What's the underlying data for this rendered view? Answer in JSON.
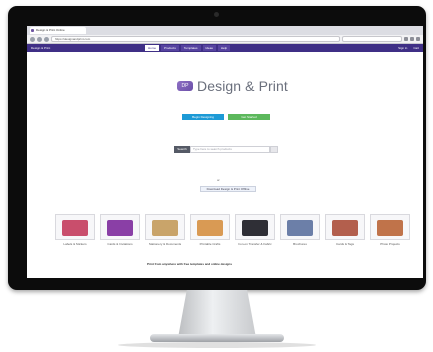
{
  "browser": {
    "tab_title": "Design & Print Online",
    "url": "https://designandprint.com"
  },
  "site_nav": {
    "brand": "Design & Print",
    "menu": [
      {
        "label": "Home",
        "active": true
      },
      {
        "label": "Products",
        "active": false
      },
      {
        "label": "Templates",
        "active": false
      },
      {
        "label": "Ideas",
        "active": false
      },
      {
        "label": "Help",
        "active": false
      }
    ],
    "right": [
      "Sign in",
      "Cart"
    ]
  },
  "hero": {
    "logo_mark": "DP",
    "logo_text": "Design & Print"
  },
  "cta": {
    "primary": "Begin Designing",
    "secondary": "Get Started"
  },
  "search": {
    "label": "Search",
    "placeholder": "Type here to search products"
  },
  "links": {
    "small": "or",
    "promo": "Download Design & Print Offline"
  },
  "products": [
    {
      "label": "Labels & Stickers",
      "color": "#c94e6c"
    },
    {
      "label": "Cards & Invitations",
      "color": "#8a3fa6"
    },
    {
      "label": "Stationery & Documents",
      "color": "#c9a46a"
    },
    {
      "label": "Printable Crafts",
      "color": "#d99a54"
    },
    {
      "label": "Iron-on Transfer & Fabric",
      "color": "#2f2f36"
    },
    {
      "label": "Brochures",
      "color": "#6c7fa8"
    },
    {
      "label": "Cards & Tags",
      "color": "#b35f4d"
    },
    {
      "label": "Photo Projects",
      "color": "#c0734a"
    }
  ],
  "footer": {
    "text": "Print from anywhere with free templates and online designs"
  },
  "colors": {
    "nav": "#3f2f86",
    "primary_button": "#1d9ad6",
    "secondary_button": "#5cb85c"
  }
}
